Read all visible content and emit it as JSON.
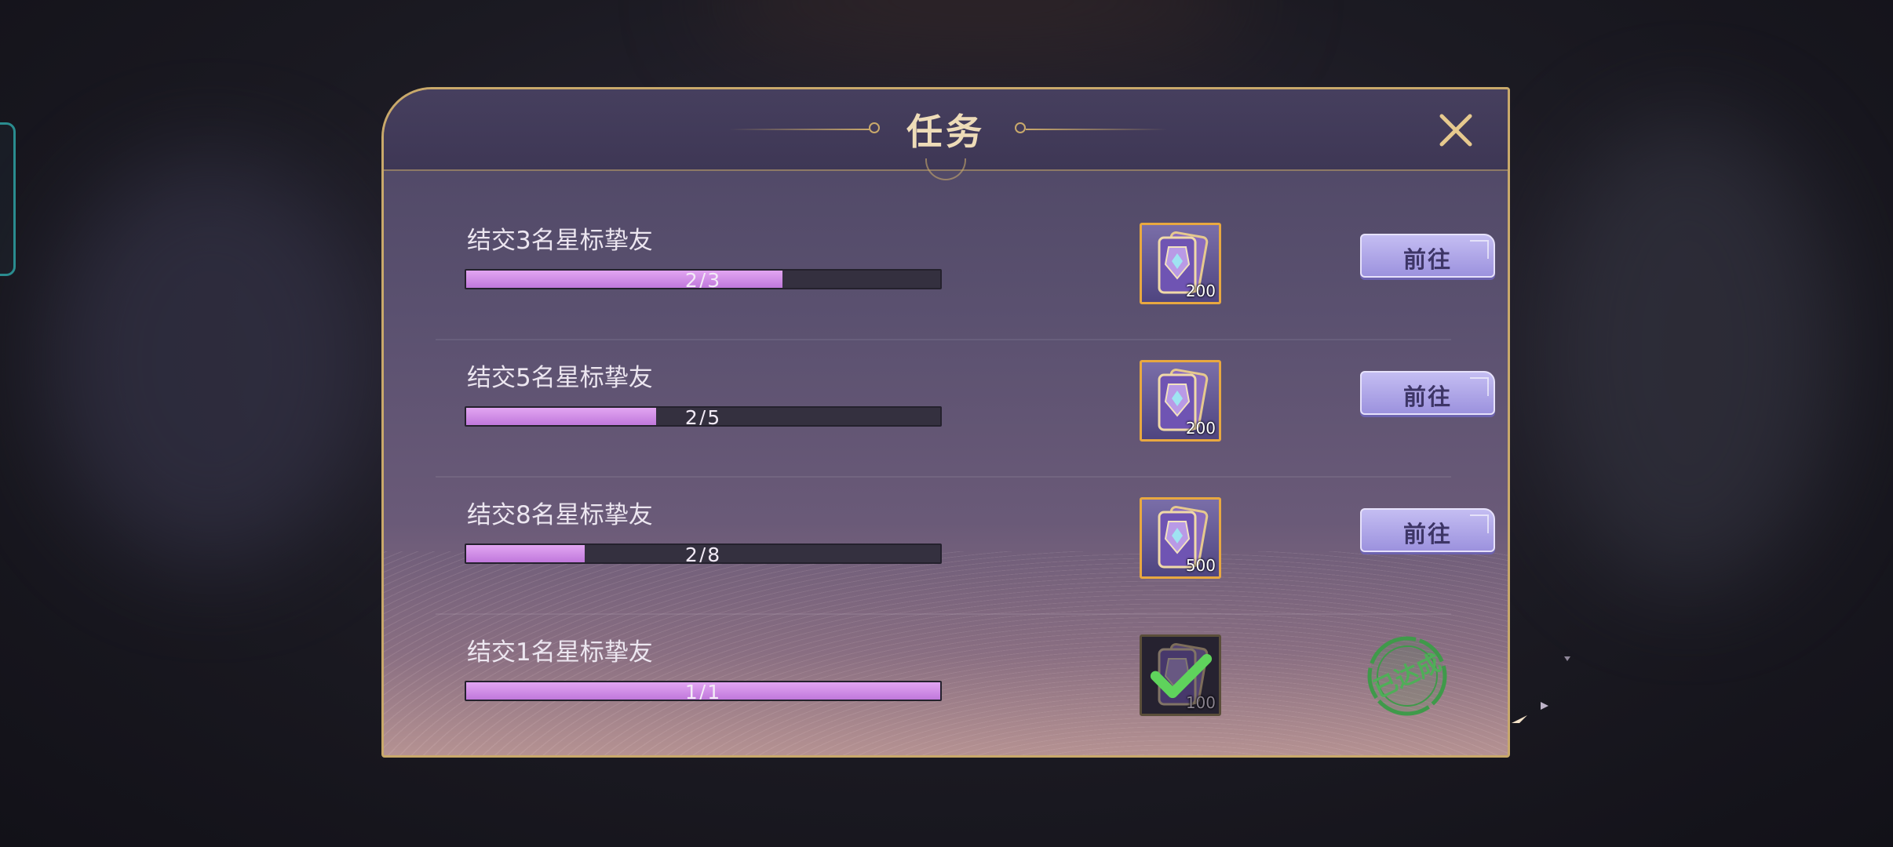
{
  "dialog": {
    "title": "任务",
    "close_icon": "close-icon"
  },
  "tasks": [
    {
      "name": "结交3名星标挚友",
      "progress_text": "2/3",
      "progress": 0.6667,
      "reward_icon": "card-pack-icon",
      "reward_count": "200",
      "action_label": "前往",
      "completed": false
    },
    {
      "name": "结交5名星标挚友",
      "progress_text": "2/5",
      "progress": 0.4,
      "reward_icon": "card-pack-icon",
      "reward_count": "200",
      "action_label": "前往",
      "completed": false
    },
    {
      "name": "结交8名星标挚友",
      "progress_text": "2/8",
      "progress": 0.25,
      "reward_icon": "card-pack-icon",
      "reward_count": "500",
      "action_label": "前往",
      "completed": false
    },
    {
      "name": "结交1名星标挚友",
      "progress_text": "1/1",
      "progress": 1.0,
      "reward_icon": "card-pack-icon",
      "reward_count": "100",
      "status_stamp": "已达成",
      "completed": true
    }
  ],
  "colors": {
    "accent_gold": "#c9a96b",
    "progress_fill": "#c078dc",
    "button": "#b3aaf0",
    "stamp_green": "#3f9a4a"
  }
}
